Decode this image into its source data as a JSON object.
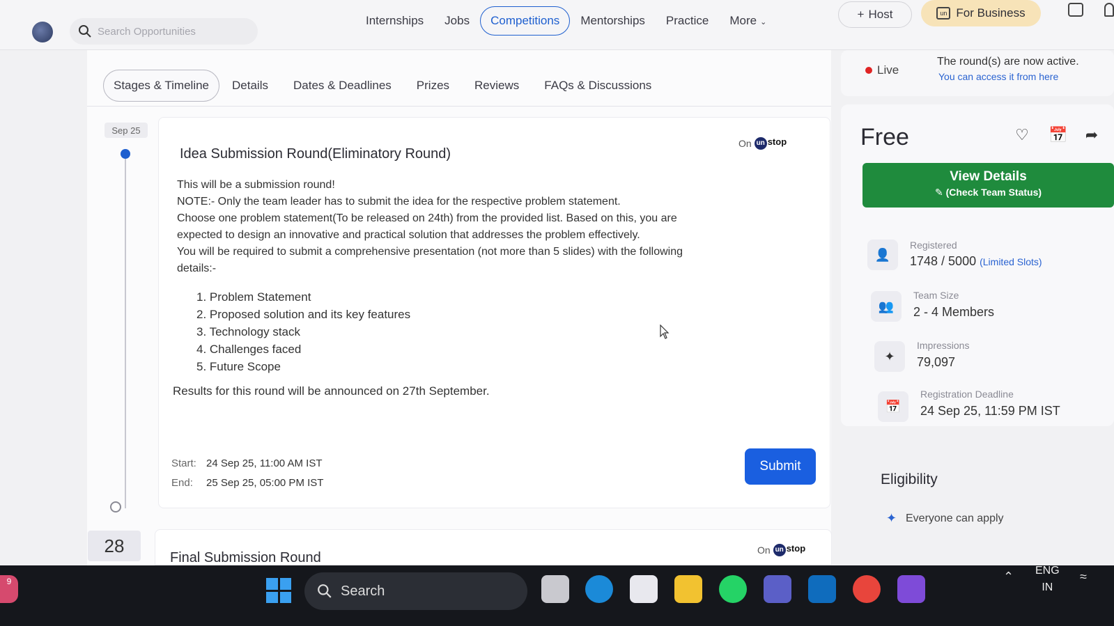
{
  "nav": {
    "search_placeholder": "Search Opportunities",
    "links": [
      "Internships",
      "Jobs",
      "Competitions",
      "Mentorships",
      "Practice",
      "More"
    ],
    "active_link": "Competitions",
    "host_label": "Host",
    "business_label": "For Business"
  },
  "subtabs": [
    "Stages & Timeline",
    "Details",
    "Dates & Deadlines",
    "Prizes",
    "Reviews",
    "FAQs & Discussions"
  ],
  "timeline": {
    "date_label": "Sep 25",
    "round": {
      "title": "Idea Submission Round(Eliminatory Round)",
      "on_label": "On",
      "platform": "stop",
      "platform_mark": "un",
      "desc_lines": [
        "This will be a submission round!",
        "NOTE:- Only the team leader has to submit the idea for the respective problem statement.",
        "Choose one problem statement(To be released on 24th)  from the provided list. Based on this, you are",
        "expected to design an innovative and practical solution that addresses the problem effectively.",
        "You will be required to submit a comprehensive presentation (not more than 5 slides) with the following",
        "details:-"
      ],
      "requirements": [
        "1. Problem Statement",
        "2. Proposed solution and its key features",
        "3. Technology stack",
        "4. Challenges faced",
        "5. Future Scope"
      ],
      "results_text": "Results for this round will be announced on 27th September.",
      "start_label": "Start:",
      "start_value": "24 Sep 25, 11:00 AM IST",
      "end_label": "End:",
      "end_value": "25 Sep 25, 05:00 PM IST",
      "submit_label": "Submit"
    },
    "next_date": "28",
    "next_round": {
      "title": "Final Submission Round",
      "on_label": "On",
      "platform": "stop",
      "platform_mark": "un"
    }
  },
  "sidebar": {
    "live_label": "Live",
    "live_message": "The round(s) are now active.",
    "live_link": "You can access it from here",
    "price": "Free",
    "view_details_label": "View Details",
    "view_details_sub": "(Check Team Status)",
    "stats": [
      {
        "icon": "registered-user-icon",
        "label": "Registered",
        "value": "1748 / 5000",
        "extra": "(Limited Slots)"
      },
      {
        "icon": "team-icon",
        "label": "Team Size",
        "value": "2 - 4 Members"
      },
      {
        "icon": "sparkle-icon",
        "label": "Impressions",
        "value": "79,097"
      },
      {
        "icon": "calendar-icon",
        "label": "Registration Deadline",
        "value": "24 Sep 25, 11:59 PM IST"
      }
    ],
    "eligibility_title": "Eligibility",
    "eligibility_item": "Everyone can apply"
  },
  "taskbar": {
    "search_label": "Search",
    "lang_line1": "ENG",
    "lang_line2": "IN",
    "badge_count": "9"
  },
  "colors": {
    "primary": "#1a5fe0",
    "success": "#1f8b3d",
    "live": "#e02424",
    "business": "#f7e3b8"
  }
}
